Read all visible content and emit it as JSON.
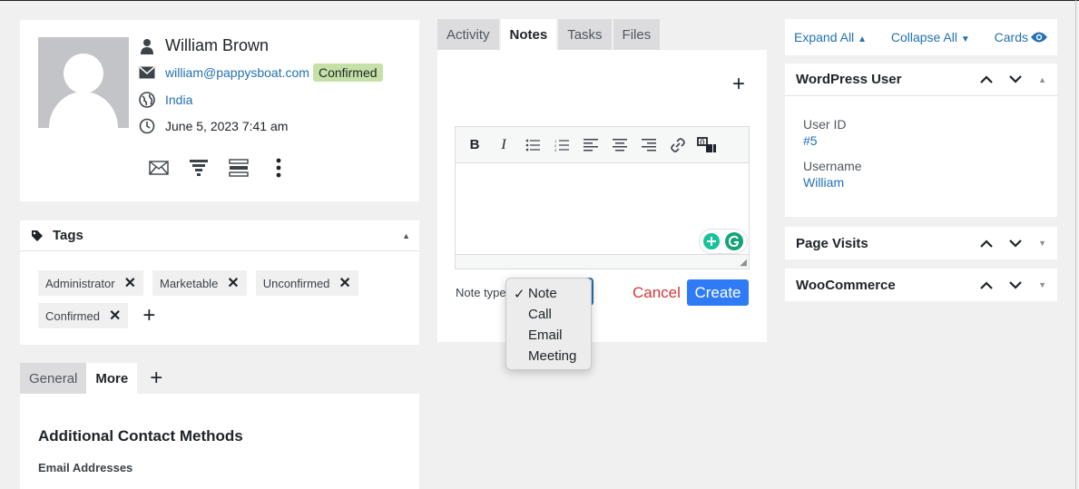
{
  "contact": {
    "name": "William Brown",
    "email": "william@pappysboat.com",
    "status": "Confirmed",
    "country": "India",
    "date": "June 5, 2023 7:41 am"
  },
  "tags": {
    "title": "Tags",
    "items": [
      "Administrator",
      "Marketable",
      "Unconfirmed",
      "Confirmed"
    ]
  },
  "bottom_tabs": {
    "general": "General",
    "more": "More"
  },
  "more": {
    "heading": "Additional Contact Methods",
    "sub": "Email Addresses"
  },
  "activity_tabs": [
    "Activity",
    "Notes",
    "Tasks",
    "Files"
  ],
  "notes": {
    "note_type_label": "Note type",
    "cancel": "Cancel",
    "create": "Create",
    "options": [
      "Note",
      "Call",
      "Email",
      "Meeting"
    ],
    "selected": "Note"
  },
  "side": {
    "expand_all": "Expand All",
    "collapse_all": "Collapse All",
    "cards": "Cards",
    "wp_title": "WordPress User",
    "user_id_label": "User ID",
    "user_id": "#5",
    "username_label": "Username",
    "username": "William",
    "page_visits": "Page Visits",
    "woocommerce": "WooCommerce"
  },
  "colors": {
    "accent": "#2271b1",
    "confirmed": "#c6e1a7",
    "create": "#2f7bf5",
    "cancel": "#d63638"
  }
}
